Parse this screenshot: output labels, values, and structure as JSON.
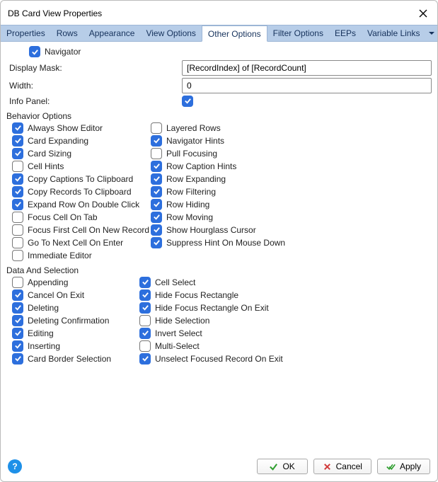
{
  "window": {
    "title": "DB Card View Properties"
  },
  "tabs": {
    "t0": "Properties",
    "t1": "Rows",
    "t2": "Appearance",
    "t3": "View Options",
    "t4": "Other Options",
    "t5": "Filter Options",
    "t6": "EEPs",
    "t7": "Variable Links"
  },
  "top": {
    "navigator": "Navigator",
    "display_mask_label": "Display Mask:",
    "display_mask_value": "[RecordIndex] of [RecordCount]",
    "width_label": "Width:",
    "width_value": "0",
    "info_panel_label": "Info Panel:"
  },
  "sections": {
    "behavior": "Behavior Options",
    "data": "Data And Selection"
  },
  "behavior": {
    "always_show_editor": "Always Show Editor",
    "layered_rows": "Layered Rows",
    "card_expanding": "Card Expanding",
    "navigator_hints": "Navigator Hints",
    "card_sizing": "Card Sizing",
    "pull_focusing": "Pull Focusing",
    "cell_hints": "Cell Hints",
    "row_caption_hints": "Row Caption Hints",
    "copy_captions": "Copy Captions To Clipboard",
    "row_expanding": "Row Expanding",
    "copy_records": "Copy Records To Clipboard",
    "row_filtering": "Row Filtering",
    "expand_row_dblclick": "Expand Row On Double Click",
    "row_hiding": "Row Hiding",
    "focus_cell_on_tab": "Focus Cell On Tab",
    "row_moving": "Row Moving",
    "focus_first_new_record": "Focus First Cell On New Record",
    "show_hourglass": "Show Hourglass Cursor",
    "go_next_on_enter": "Go To Next Cell On Enter",
    "suppress_hint_mousedown": "Suppress Hint On Mouse Down",
    "immediate_editor": "Immediate Editor"
  },
  "data": {
    "appending": "Appending",
    "cell_select": "Cell Select",
    "cancel_on_exit": "Cancel On Exit",
    "hide_focus_rect": "Hide Focus Rectangle",
    "deleting": "Deleting",
    "hide_focus_rect_exit": "Hide Focus Rectangle On Exit",
    "deleting_confirm": "Deleting Confirmation",
    "hide_selection": "Hide Selection",
    "editing": "Editing",
    "invert_select": "Invert Select",
    "inserting": "Inserting",
    "multi_select": "Multi-Select",
    "card_border_selection": "Card Border Selection",
    "unselect_focused_exit": "Unselect Focused Record On Exit"
  },
  "footer": {
    "ok": "OK",
    "cancel": "Cancel",
    "apply": "Apply"
  }
}
